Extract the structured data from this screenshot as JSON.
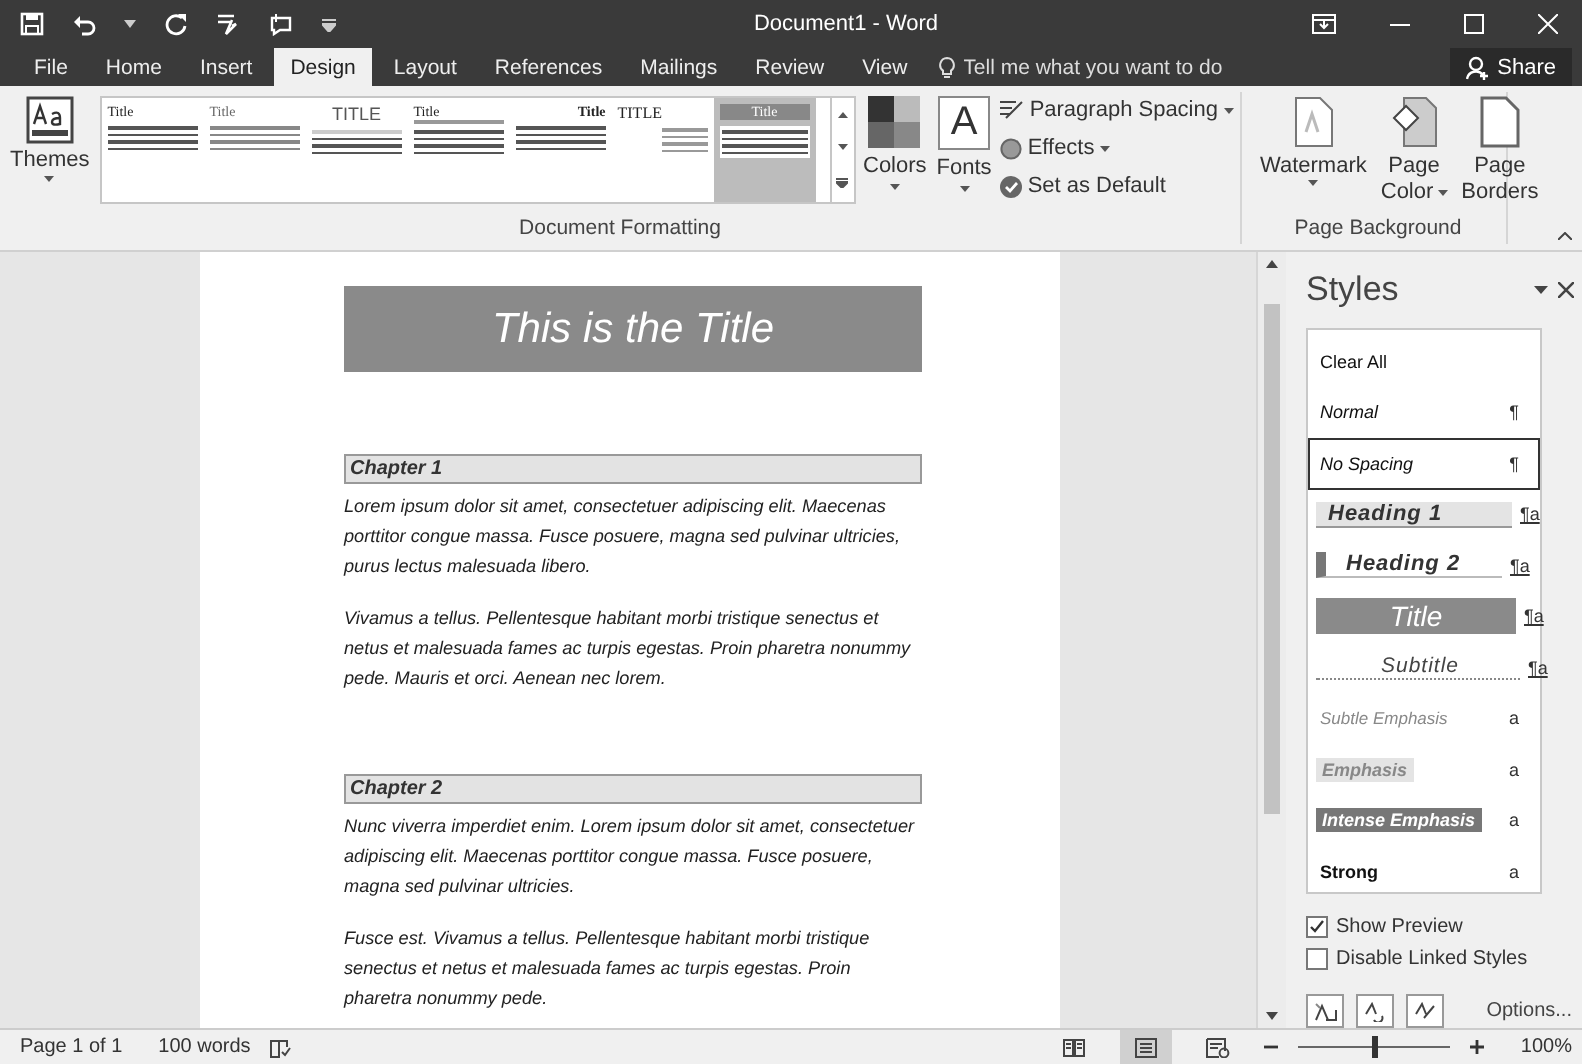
{
  "window": {
    "title": "Document1 - Word"
  },
  "tabs": [
    {
      "label": "File",
      "selected": false
    },
    {
      "label": "Home",
      "selected": false
    },
    {
      "label": "Insert",
      "selected": false
    },
    {
      "label": "Design",
      "selected": true
    },
    {
      "label": "Layout",
      "selected": false
    },
    {
      "label": "References",
      "selected": false
    },
    {
      "label": "Mailings",
      "selected": false
    },
    {
      "label": "Review",
      "selected": false
    },
    {
      "label": "View",
      "selected": false
    }
  ],
  "tell_me": {
    "placeholder": "Tell me what you want to do"
  },
  "share_button": "Share",
  "ribbon": {
    "themes_button": "Themes",
    "style_sets": [
      {
        "title": "Title",
        "kind": "left",
        "selected": false
      },
      {
        "title": "Title",
        "kind": "light",
        "selected": false
      },
      {
        "title": "TITLE",
        "kind": "caps-center",
        "selected": false
      },
      {
        "title": "Title",
        "kind": "underline",
        "selected": false
      },
      {
        "title": "Title",
        "kind": "right",
        "selected": false
      },
      {
        "title": "TITLE",
        "kind": "caps-left",
        "selected": false
      },
      {
        "title": "Title",
        "kind": "banner",
        "selected": true
      }
    ],
    "font_sample": "A",
    "colors_button": "Colors",
    "fonts_button": "Fonts",
    "paragraph_spacing": "Paragraph Spacing",
    "effects": "Effects",
    "set_as_default": "Set as Default",
    "formatting_group": "Document Formatting",
    "background_buttons": [
      {
        "kind": "watermark",
        "lines": [
          "Watermark"
        ]
      },
      {
        "kind": "page-color",
        "lines": [
          "Page",
          "Color"
        ]
      },
      {
        "kind": "page-borders",
        "lines": [
          "Page",
          "Borders"
        ]
      }
    ],
    "background_group": "Page Background"
  },
  "document": {
    "title": "This is the Title",
    "sections": [
      {
        "heading": "Chapter 1",
        "paragraphs": [
          "Lorem ipsum dolor sit amet, consectetuer adipiscing elit. Maecenas porttitor congue massa. Fusce posuere, magna sed pulvinar ultricies, purus lectus malesuada libero.",
          "Vivamus a tellus. Pellentesque habitant morbi tristique senectus et netus et malesuada fames ac turpis egestas. Proin pharetra nonummy pede. Mauris et orci. Aenean nec lorem."
        ]
      },
      {
        "heading": "Chapter 2",
        "paragraphs": [
          "Nunc viverra imperdiet enim. Lorem ipsum dolor sit amet, consectetuer adipiscing elit. Maecenas porttitor congue massa. Fusce posuere, magna sed pulvinar ultricies.",
          "Fusce est. Vivamus a tellus. Pellentesque habitant morbi tristique senectus et netus et malesuada fames ac turpis egestas. Proin pharetra nonummy pede."
        ]
      }
    ]
  },
  "styles_pane": {
    "title": "Styles",
    "items": [
      {
        "name": "Clear All",
        "kind": "clear",
        "selected": false
      },
      {
        "name": "Normal",
        "kind": "normal",
        "mark": "¶",
        "selected": false
      },
      {
        "name": "No Spacing",
        "kind": "normal",
        "mark": "¶",
        "selected": true
      },
      {
        "name": "Heading 1",
        "kind": "heading1",
        "mark": "¶a",
        "selected": false
      },
      {
        "name": "Heading 2",
        "kind": "heading2",
        "mark": "¶a",
        "selected": false
      },
      {
        "name": "Title",
        "kind": "title",
        "mark": "¶a",
        "selected": false
      },
      {
        "name": "Subtitle",
        "kind": "subtitle",
        "mark": "¶a",
        "selected": false
      },
      {
        "name": "Subtle Emphasis",
        "kind": "subtle",
        "mark": "a",
        "selected": false
      },
      {
        "name": "Emphasis",
        "kind": "emphasis",
        "mark": "a",
        "selected": false
      },
      {
        "name": "Intense Emphasis",
        "kind": "intense",
        "mark": "a",
        "selected": false
      },
      {
        "name": "Strong",
        "kind": "strong",
        "mark": "a",
        "selected": false
      }
    ],
    "checkboxes": [
      {
        "label": "Show Preview",
        "checked": true
      },
      {
        "label": "Disable Linked Styles",
        "checked": false
      }
    ],
    "options_link": "Options..."
  },
  "status_bar": {
    "page": "Page 1 of 1",
    "words": "100 words",
    "views": [
      {
        "kind": "read",
        "selected": false
      },
      {
        "kind": "print",
        "selected": true
      },
      {
        "kind": "web",
        "selected": false
      }
    ],
    "zoom_slider": {
      "level": 0.5
    },
    "zoom": "100%"
  }
}
